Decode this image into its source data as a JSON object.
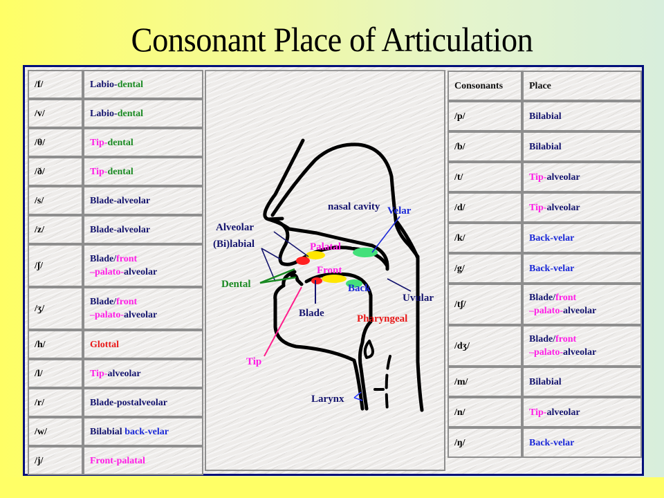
{
  "title": "Consonant Place of Articulation",
  "colors": {
    "navy": "#14146e",
    "green": "#1a8a22",
    "magenta": "#ff1ee6",
    "red": "#e81818",
    "blue": "#1a28d8",
    "frame": "#000f7a"
  },
  "left_table": {
    "rows": [
      {
        "symbol": "/f/",
        "place": [
          {
            "text": "Labio-",
            "color": "navy"
          },
          {
            "text": "dental",
            "color": "green"
          }
        ]
      },
      {
        "symbol": "/v/",
        "place": [
          {
            "text": "Labio-",
            "color": "navy"
          },
          {
            "text": "dental",
            "color": "green"
          }
        ]
      },
      {
        "symbol": "/θ/",
        "place": [
          {
            "text": "Tip-",
            "color": "magenta"
          },
          {
            "text": "dental",
            "color": "green"
          }
        ]
      },
      {
        "symbol": "/ð/",
        "place": [
          {
            "text": "Tip-",
            "color": "magenta"
          },
          {
            "text": "dental",
            "color": "green"
          }
        ]
      },
      {
        "symbol": "/s/",
        "place": [
          {
            "text": "Blade-alveolar",
            "color": "navy"
          }
        ]
      },
      {
        "symbol": "/z/",
        "place": [
          {
            "text": "Blade-alveolar",
            "color": "navy"
          }
        ]
      },
      {
        "symbol": "/ʃ/",
        "place": [
          {
            "text": "Blade/",
            "color": "navy"
          },
          {
            "text": "front",
            "color": "magenta"
          },
          {
            "text": "\n",
            "color": "navy"
          },
          {
            "text": "–palato-",
            "color": "magenta"
          },
          {
            "text": "alveolar",
            "color": "navy"
          }
        ]
      },
      {
        "symbol": "/ʒ/",
        "place": [
          {
            "text": "Blade/",
            "color": "navy"
          },
          {
            "text": "front",
            "color": "magenta"
          },
          {
            "text": "\n",
            "color": "navy"
          },
          {
            "text": "–palato-",
            "color": "magenta"
          },
          {
            "text": "alveolar",
            "color": "navy"
          }
        ]
      },
      {
        "symbol": "/h/",
        "place": [
          {
            "text": "Glottal",
            "color": "red"
          }
        ]
      },
      {
        "symbol": "/l/",
        "place": [
          {
            "text": "Tip-",
            "color": "magenta"
          },
          {
            "text": "alveolar",
            "color": "navy"
          }
        ]
      },
      {
        "symbol": "/r/",
        "place": [
          {
            "text": "Blade-postalveolar",
            "color": "navy"
          }
        ]
      },
      {
        "symbol": "/w/",
        "place": [
          {
            "text": "Bilabial ",
            "color": "navy"
          },
          {
            "text": "back-velar",
            "color": "blue"
          }
        ]
      },
      {
        "symbol": "/j/",
        "place": [
          {
            "text": "Front-palatal",
            "color": "magenta"
          }
        ]
      }
    ]
  },
  "right_table": {
    "headers": [
      "Consonants",
      "Place"
    ],
    "rows": [
      {
        "symbol": "/p/",
        "place": [
          {
            "text": "Bilabial",
            "color": "navy"
          }
        ]
      },
      {
        "symbol": "/b/",
        "place": [
          {
            "text": "Bilabial",
            "color": "navy"
          }
        ]
      },
      {
        "symbol": "/t/",
        "place": [
          {
            "text": "Tip-",
            "color": "magenta"
          },
          {
            "text": "alveolar",
            "color": "navy"
          }
        ]
      },
      {
        "symbol": "/d/",
        "place": [
          {
            "text": "Tip-",
            "color": "magenta"
          },
          {
            "text": "alveolar",
            "color": "navy"
          }
        ]
      },
      {
        "symbol": "/k/",
        "place": [
          {
            "text": "Back-velar",
            "color": "blue"
          }
        ]
      },
      {
        "symbol": "/g/",
        "place": [
          {
            "text": "Back-velar",
            "color": "blue"
          }
        ]
      },
      {
        "symbol": "/tʃ/",
        "place": [
          {
            "text": "Blade/",
            "color": "navy"
          },
          {
            "text": "front",
            "color": "magenta"
          },
          {
            "text": "\n",
            "color": "navy"
          },
          {
            "text": "–palato-",
            "color": "magenta"
          },
          {
            "text": "alveolar",
            "color": "navy"
          }
        ]
      },
      {
        "symbol": "/dʒ/",
        "place": [
          {
            "text": "Blade/",
            "color": "navy"
          },
          {
            "text": "front",
            "color": "magenta"
          },
          {
            "text": "\n",
            "color": "navy"
          },
          {
            "text": "–palato-",
            "color": "magenta"
          },
          {
            "text": "alveolar",
            "color": "navy"
          }
        ]
      },
      {
        "symbol": "/m/",
        "place": [
          {
            "text": "Bilabial",
            "color": "navy"
          }
        ]
      },
      {
        "symbol": "/n/",
        "place": [
          {
            "text": "Tip-",
            "color": "magenta"
          },
          {
            "text": "alveolar",
            "color": "navy"
          }
        ]
      },
      {
        "symbol": "/ŋ/",
        "place": [
          {
            "text": "Back-velar",
            "color": "blue"
          }
        ]
      }
    ]
  },
  "diagram": {
    "labels": {
      "nasal_cavity": "nasal cavity",
      "velar": "Velar",
      "alveolar": "Alveolar",
      "bilabial": "(Bi)labial",
      "palatal": "Palatal",
      "front": "Front",
      "back": "Back",
      "dental": "Dental",
      "uvular": "Uvular",
      "blade": "Blade",
      "pharyngeal": "Pharyngeal",
      "tip": "Tip",
      "larynx": "Larynx"
    }
  }
}
